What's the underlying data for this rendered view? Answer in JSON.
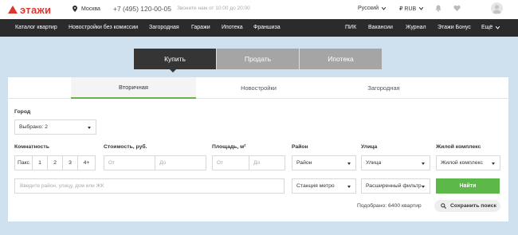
{
  "header": {
    "logo_text": "этажи",
    "city": "Москва",
    "phone": "+7 (495) 120-00-05",
    "call_hours": "Звоните нам от 10:00 до 20:00",
    "language": "Русский",
    "currency": "₽ RUB"
  },
  "nav": {
    "items": [
      "Каталог квартир",
      "Новостройки без комиссии",
      "Загородная",
      "Гаражи",
      "Ипотека",
      "Франшиза",
      "ПИК",
      "Вакансии",
      "Журнал",
      "Этажи Бонус"
    ],
    "more": "Ещё"
  },
  "modes": [
    "Купить",
    "Продать",
    "Ипотека"
  ],
  "tabs": [
    "Вторичная",
    "Новостройки",
    "Загородная"
  ],
  "filters": {
    "city_label": "Город",
    "city_value": "Выбрано: 2",
    "rooms_label": "Комнатность",
    "rooms": [
      "Пакс",
      "1",
      "2",
      "3",
      "4+"
    ],
    "price_label": "Стоимость, руб.",
    "price_from": "От",
    "price_to": "До",
    "area_label": "Площадь, м²",
    "area_from": "От",
    "area_to": "До",
    "district_label": "Район",
    "district_value": "Район",
    "street_label": "Улица",
    "street_value": "Улица",
    "complex_label": "Жилой комплекс",
    "complex_value": "Жилой комплекс",
    "search_placeholder": "Введите район, улицу, дом или ЖК",
    "metro_value": "Станция метро",
    "advanced_value": "Расширенный фильтр",
    "find_button": "Найти",
    "found_text": "Подобрано: 6400 квартир",
    "save_search": "Сохранить поиск"
  },
  "colors": {
    "brand_red": "#e0362e",
    "accent_green": "#5cb848",
    "nav_dark": "#2b2b2b",
    "page_bg": "#cfe0ee"
  }
}
